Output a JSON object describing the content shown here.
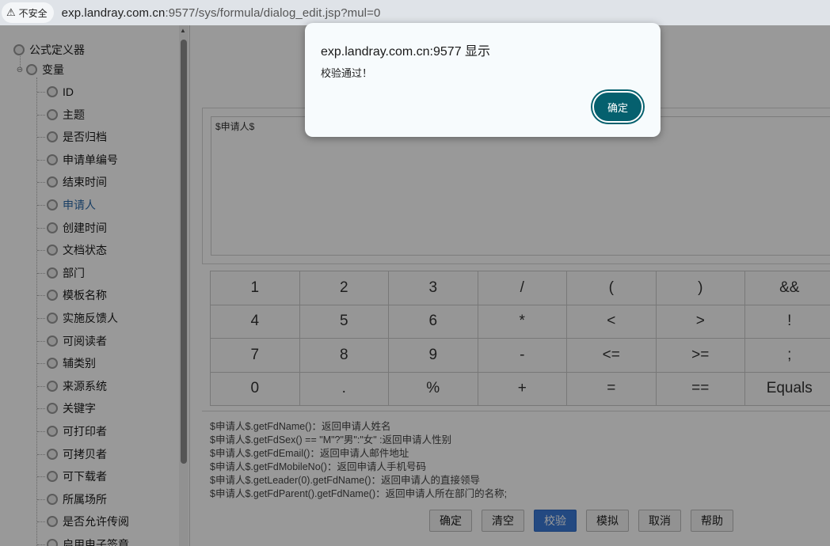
{
  "browser": {
    "security_label": "不安全",
    "url_host": "exp.landray.com.cn",
    "url_rest": ":9577/sys/formula/dialog_edit.jsp?mul=0"
  },
  "tree": {
    "root_label": "公式定义器",
    "group_label": "变量",
    "items": [
      "ID",
      "主题",
      "是否归档",
      "申请单编号",
      "结束时间",
      "申请人",
      "创建时间",
      "文档状态",
      "部门",
      "模板名称",
      "实施反馈人",
      "可阅读者",
      "辅类别",
      "来源系统",
      "关键字",
      "可打印者",
      "可拷贝者",
      "可下载者",
      "所属场所",
      "是否允许传阅",
      "启用电子签章"
    ],
    "active_item": "申请人"
  },
  "editor": {
    "content": "$申请人$"
  },
  "keypad": {
    "rows": [
      [
        "1",
        "2",
        "3",
        "/",
        "(",
        ")",
        "&&"
      ],
      [
        "4",
        "5",
        "6",
        "*",
        "<",
        ">",
        "!"
      ],
      [
        "7",
        "8",
        "9",
        "-",
        "<=",
        ">=",
        ";"
      ],
      [
        "0",
        ".",
        "%",
        "+",
        "=",
        "==",
        "Equals"
      ]
    ]
  },
  "hints": [
    "$申请人$.getFdName()：返回申请人姓名",
    "$申请人$.getFdSex() == \"M\"?\"男\":\"女\" :返回申请人性别",
    "$申请人$.getFdEmail()：返回申请人邮件地址",
    "$申请人$.getFdMobileNo()：返回申请人手机号码",
    "$申请人$.getLeader(0).getFdName()：返回申请人的直接领导",
    "$申请人$.getFdParent().getFdName()：返回申请人所在部门的名称;"
  ],
  "buttons": {
    "confirm": "确定",
    "clear": "清空",
    "validate": "校验",
    "simulate": "模拟",
    "cancel": "取消",
    "help": "帮助"
  },
  "dialog": {
    "title": "exp.landray.com.cn:9577 显示",
    "message": "校验通过！",
    "ok_label": "确定"
  },
  "colors": {
    "dialog_ok": "#05606e",
    "validate_button": "#3b7bd8",
    "active_tree_item": "#2a6aa8"
  }
}
